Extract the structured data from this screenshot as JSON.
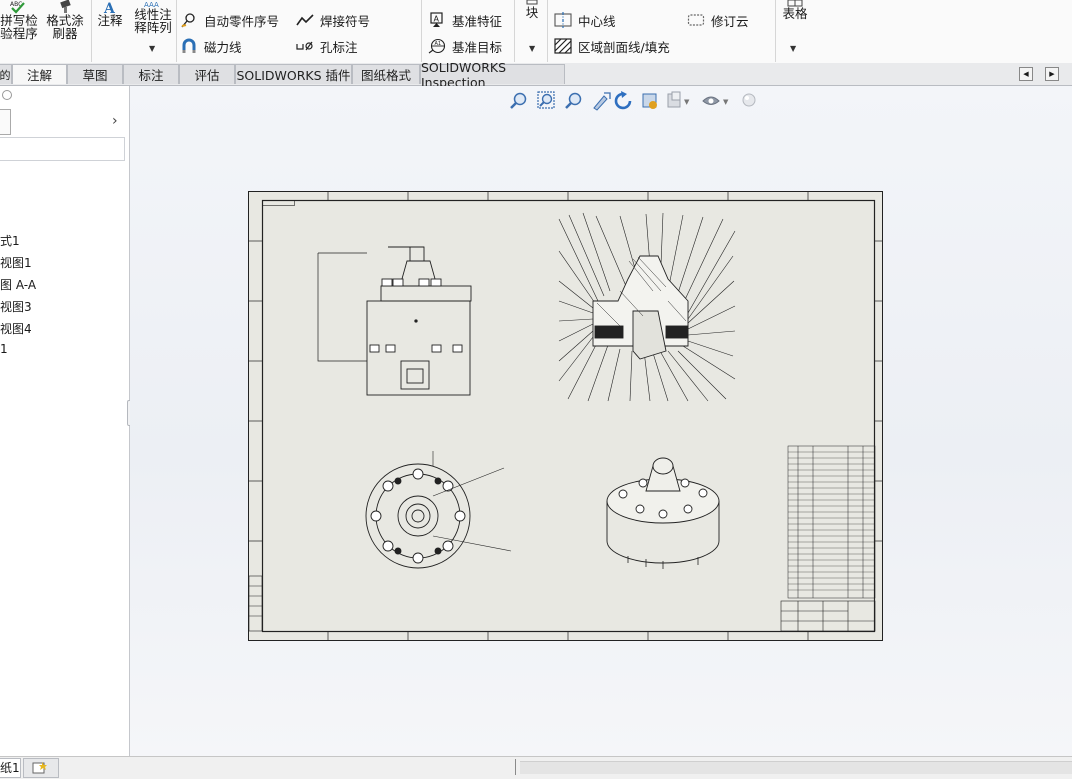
{
  "ribbon": {
    "spell_check": {
      "line1": "拼写检",
      "line2": "验程序"
    },
    "format_painter": {
      "line1": "格式涂",
      "line2": "刷器"
    },
    "note": "注释",
    "linear_pattern": {
      "line1": "线性注",
      "line2": "释阵列"
    },
    "auto_balloon": "自动零件序号",
    "magnetic_line": "磁力线",
    "weld_symbol": "焊接符号",
    "hole_callout": "孔标注",
    "datum_feature": "基准特征",
    "datum_target": "基准目标",
    "block": "块",
    "center_line": "中心线",
    "area_hatch": "区域剖面线/填充",
    "revision_cloud": "修订云",
    "tables": "表格"
  },
  "tabs": [
    {
      "label": "注解",
      "active": true
    },
    {
      "label": "草图"
    },
    {
      "label": "标注"
    },
    {
      "label": "评估"
    },
    {
      "label": "SOLIDWORKS 插件"
    },
    {
      "label": "图纸格式"
    },
    {
      "label": "SOLIDWORKS Inspection"
    }
  ],
  "tree": {
    "items": [
      "式1",
      "视图1",
      "图 A-A",
      "视图3",
      "视图4",
      "1"
    ]
  },
  "bottom": {
    "sheet_tab": "纸1"
  },
  "colors": {
    "sheet_bg": "#e8e8e2",
    "canvas_bg": "#eceff4",
    "accent": "#2a6fb5"
  }
}
